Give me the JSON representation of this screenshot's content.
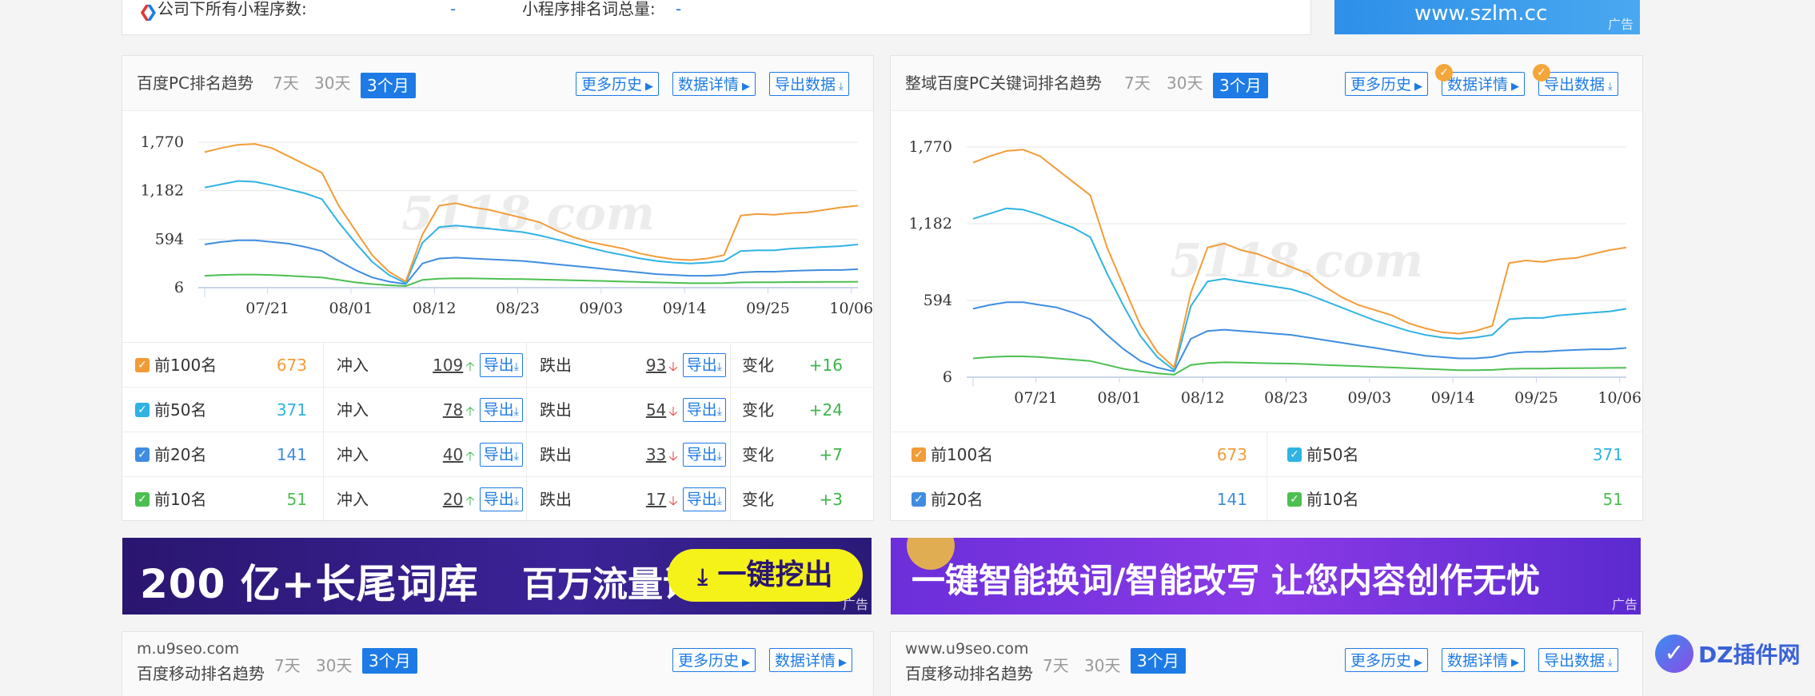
{
  "top": {
    "company_label": "公司下所有小程序数:",
    "company_value": "-",
    "keywords_label": "小程序排名词总量:",
    "keywords_value": "-",
    "ad_url": "www.szlm.cc",
    "ad_label": "广告"
  },
  "pc_panel": {
    "title": "百度PC排名趋势",
    "ranges": [
      "7天",
      "30天",
      "3个月"
    ],
    "active_range": "3个月",
    "buttons": {
      "history": "更多历史",
      "detail": "数据详情",
      "export": "导出数据"
    },
    "rows": [
      {
        "label": "前100名",
        "value": "673",
        "color": "#f29c38",
        "in_label": "冲入",
        "in_value": "109",
        "out_label": "跌出",
        "out_value": "93",
        "export": "导出",
        "change_label": "变化",
        "change_value": "+16"
      },
      {
        "label": "前50名",
        "value": "371",
        "color": "#2fb3e3",
        "in_label": "冲入",
        "in_value": "78",
        "out_label": "跌出",
        "out_value": "54",
        "export": "导出",
        "change_label": "变化",
        "change_value": "+24"
      },
      {
        "label": "前20名",
        "value": "141",
        "color": "#3f8de0",
        "in_label": "冲入",
        "in_value": "40",
        "out_label": "跌出",
        "out_value": "33",
        "export": "导出",
        "change_label": "变化",
        "change_value": "+7"
      },
      {
        "label": "前10名",
        "value": "51",
        "color": "#4cbf50",
        "in_label": "冲入",
        "in_value": "20",
        "out_label": "跌出",
        "out_value": "17",
        "export": "导出",
        "change_label": "变化",
        "change_value": "+3"
      }
    ]
  },
  "kw_panel": {
    "title": "整域百度PC关键词排名趋势",
    "ranges": [
      "7天",
      "30天",
      "3个月"
    ],
    "active_range": "3个月",
    "buttons": {
      "history": "更多历史",
      "detail": "数据详情",
      "export": "导出数据"
    },
    "items": [
      {
        "label": "前100名",
        "value": "673",
        "color": "#f29c38"
      },
      {
        "label": "前50名",
        "value": "371",
        "color": "#2fb3e3"
      },
      {
        "label": "前20名",
        "value": "141",
        "color": "#3f8de0"
      },
      {
        "label": "前10名",
        "value": "51",
        "color": "#4cbf50"
      }
    ]
  },
  "banners": {
    "left_text_a": "200 亿+长尾词库",
    "left_text_b": "百万流量词",
    "left_button": "一键挖出",
    "right_text": "一键智能换词/智能改写 让您内容创作无忧",
    "ad_label": "广告"
  },
  "bottom_left": {
    "domain": "m.u9seo.com",
    "title": "百度移动排名趋势",
    "ranges": [
      "7天",
      "30天",
      "3个月"
    ],
    "buttons": {
      "history": "更多历史",
      "detail": "数据详情"
    }
  },
  "bottom_right": {
    "domain": "www.u9seo.com",
    "title": "百度移动排名趋势",
    "ranges": [
      "7天",
      "30天",
      "3个月"
    ],
    "buttons": {
      "history": "更多历史",
      "detail": "数据详情",
      "export": "导出数据"
    }
  },
  "watermark": "5118.com",
  "corner_logo": "DZ插件网",
  "chart_data": [
    {
      "type": "line",
      "x_ticks": [
        "07/21",
        "08/01",
        "08/12",
        "08/23",
        "09/03",
        "09/14",
        "09/25",
        "10/06"
      ],
      "y_ticks": [
        "6",
        "594",
        "1,182",
        "1,770"
      ],
      "ylim": [
        6,
        1770
      ],
      "grid": true,
      "series": [
        {
          "name": "前100名",
          "color": "#f29c38",
          "values": [
            1650,
            1700,
            1740,
            1750,
            1700,
            1600,
            1500,
            1400,
            1000,
            700,
            400,
            200,
            80,
            650,
            1000,
            1030,
            980,
            950,
            900,
            850,
            800,
            700,
            620,
            560,
            520,
            480,
            420,
            380,
            350,
            340,
            360,
            400,
            880,
            900,
            890,
            910,
            920,
            950,
            980,
            1000
          ]
        },
        {
          "name": "前50名",
          "color": "#2fb3e3",
          "values": [
            1220,
            1260,
            1300,
            1290,
            1250,
            1200,
            1150,
            1080,
            800,
            550,
            320,
            160,
            60,
            550,
            740,
            760,
            740,
            720,
            700,
            680,
            640,
            590,
            540,
            490,
            440,
            400,
            360,
            330,
            310,
            300,
            310,
            330,
            450,
            460,
            460,
            480,
            490,
            500,
            510,
            530
          ]
        },
        {
          "name": "前20名",
          "color": "#3f8de0",
          "values": [
            530,
            560,
            580,
            580,
            560,
            540,
            500,
            450,
            330,
            220,
            130,
            80,
            50,
            300,
            360,
            370,
            360,
            350,
            340,
            330,
            310,
            290,
            270,
            250,
            230,
            210,
            190,
            170,
            160,
            150,
            150,
            160,
            190,
            200,
            200,
            210,
            215,
            220,
            220,
            230
          ]
        },
        {
          "name": "前10名",
          "color": "#4cbf50",
          "values": [
            150,
            160,
            165,
            165,
            160,
            150,
            140,
            130,
            100,
            70,
            50,
            35,
            25,
            100,
            115,
            120,
            118,
            115,
            112,
            110,
            105,
            100,
            95,
            90,
            85,
            80,
            75,
            70,
            65,
            60,
            60,
            62,
            70,
            72,
            72,
            74,
            75,
            76,
            77,
            78
          ]
        }
      ]
    },
    {
      "type": "line",
      "x_ticks": [
        "07/21",
        "08/01",
        "08/12",
        "08/23",
        "09/03",
        "09/14",
        "09/25",
        "10/06"
      ],
      "y_ticks": [
        "6",
        "594",
        "1,182",
        "1,770"
      ],
      "ylim": [
        6,
        1770
      ],
      "grid": true,
      "series": [
        {
          "name": "前100名",
          "color": "#f29c38",
          "values": [
            1650,
            1700,
            1740,
            1750,
            1700,
            1600,
            1500,
            1400,
            1000,
            700,
            400,
            200,
            80,
            650,
            1000,
            1030,
            980,
            950,
            900,
            850,
            800,
            700,
            620,
            560,
            520,
            480,
            420,
            380,
            350,
            340,
            360,
            400,
            880,
            900,
            890,
            910,
            920,
            950,
            980,
            1000
          ]
        },
        {
          "name": "前50名",
          "color": "#2fb3e3",
          "values": [
            1220,
            1260,
            1300,
            1290,
            1250,
            1200,
            1150,
            1080,
            800,
            550,
            320,
            160,
            60,
            550,
            740,
            760,
            740,
            720,
            700,
            680,
            640,
            590,
            540,
            490,
            440,
            400,
            360,
            330,
            310,
            300,
            310,
            330,
            450,
            460,
            460,
            480,
            490,
            500,
            510,
            530
          ]
        },
        {
          "name": "前20名",
          "color": "#3f8de0",
          "values": [
            530,
            560,
            580,
            580,
            560,
            540,
            500,
            450,
            330,
            220,
            130,
            80,
            50,
            300,
            360,
            370,
            360,
            350,
            340,
            330,
            310,
            290,
            270,
            250,
            230,
            210,
            190,
            170,
            160,
            150,
            150,
            160,
            190,
            200,
            200,
            210,
            215,
            220,
            220,
            230
          ]
        },
        {
          "name": "前10名",
          "color": "#4cbf50",
          "values": [
            150,
            160,
            165,
            165,
            160,
            150,
            140,
            130,
            100,
            70,
            50,
            35,
            25,
            100,
            115,
            120,
            118,
            115,
            112,
            110,
            105,
            100,
            95,
            90,
            85,
            80,
            75,
            70,
            65,
            60,
            60,
            62,
            70,
            72,
            72,
            74,
            75,
            76,
            77,
            78
          ]
        }
      ]
    }
  ]
}
